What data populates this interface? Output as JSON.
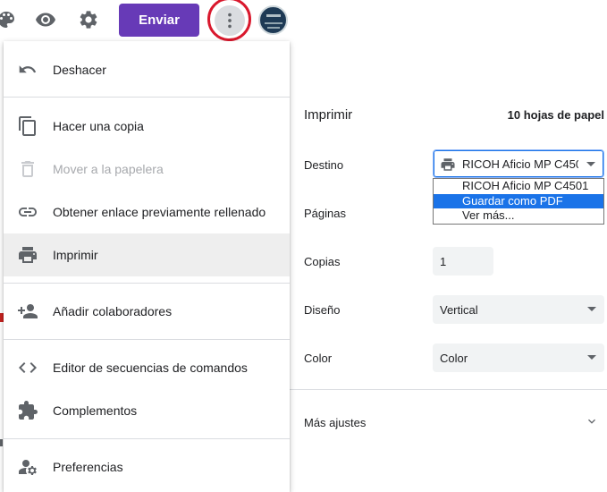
{
  "toolbar": {
    "send_label": "Enviar",
    "icons": [
      "palette-icon",
      "preview-icon",
      "settings-icon",
      "more-vert-icon",
      "avatar"
    ]
  },
  "menu": {
    "items": [
      {
        "label": "Deshacer",
        "icon": "undo-icon",
        "disabled": false
      },
      {
        "label": "Hacer una copia",
        "icon": "copy-icon",
        "disabled": false
      },
      {
        "label": "Mover a la papelera",
        "icon": "trash-icon",
        "disabled": true
      },
      {
        "label": "Obtener enlace previamente rellenado",
        "icon": "link-icon",
        "disabled": false
      },
      {
        "label": "Imprimir",
        "icon": "print-icon",
        "disabled": false,
        "highlighted": true
      },
      {
        "label": "Añadir colaboradores",
        "icon": "add-people-icon",
        "disabled": false
      },
      {
        "label": "Editor de secuencias de comandos",
        "icon": "code-icon",
        "disabled": false
      },
      {
        "label": "Complementos",
        "icon": "puzzle-icon",
        "disabled": false
      },
      {
        "label": "Preferencias",
        "icon": "person-settings-icon",
        "disabled": false
      }
    ]
  },
  "print": {
    "title": "Imprimir",
    "sheets": "10 hojas de papel",
    "destination_label": "Destino",
    "destination_value": "RICOH Aficio MP C4501",
    "destination_options": [
      "RICOH Aficio MP C4501",
      "Guardar como PDF",
      "Ver más..."
    ],
    "destination_selected_option": "Guardar como PDF",
    "pages_label": "Páginas",
    "copies_label": "Copias",
    "copies_value": "1",
    "layout_label": "Diseño",
    "layout_value": "Vertical",
    "color_label": "Color",
    "color_value": "Color",
    "more_settings_label": "Más ajustes"
  },
  "colors": {
    "send_button": "#673ab7",
    "highlight_ring": "#d9182d",
    "selected_option": "#1a73e8",
    "menu_highlight": "#eeeeee"
  }
}
